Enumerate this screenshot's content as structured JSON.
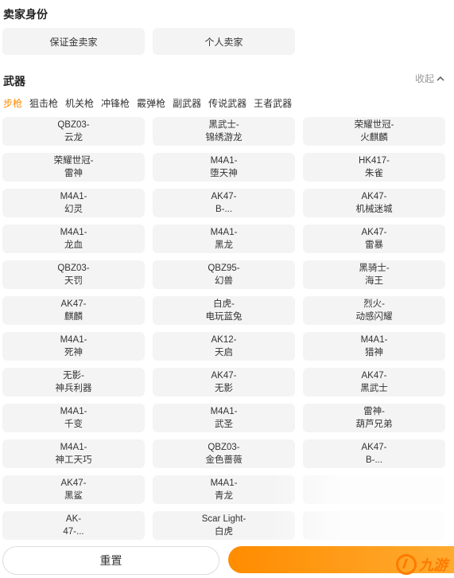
{
  "seller": {
    "title": "卖家身份",
    "options": [
      "保证金卖家",
      "个人卖家"
    ]
  },
  "weapons": {
    "title": "武器",
    "collapse_label": "收起",
    "tabs": [
      "步枪",
      "狙击枪",
      "机关枪",
      "冲锋枪",
      "霰弹枪",
      "副武器",
      "传说武器",
      "王者武器"
    ],
    "active_tab": 0,
    "items": [
      [
        "QBZ03-",
        "云龙"
      ],
      [
        "黑武士-",
        "锦绣游龙"
      ],
      [
        "荣耀世冠-",
        "火麒麟"
      ],
      [
        "荣耀世冠-",
        "雷神"
      ],
      [
        "M4A1-",
        "堕天神"
      ],
      [
        "HK417-",
        "朱雀"
      ],
      [
        "M4A1-",
        "幻灵"
      ],
      [
        "AK47-",
        "B-..."
      ],
      [
        "AK47-",
        "机械迷城"
      ],
      [
        "M4A1-",
        "龙血"
      ],
      [
        "M4A1-",
        "黑龙"
      ],
      [
        "AK47-",
        "雷暴"
      ],
      [
        "QBZ03-",
        "天罚"
      ],
      [
        "QBZ95-",
        "幻兽"
      ],
      [
        "黑骑士-",
        "海王"
      ],
      [
        "AK47-",
        "麒麟"
      ],
      [
        "白虎-",
        "电玩蓝兔"
      ],
      [
        "烈火-",
        "动感闪耀"
      ],
      [
        "M4A1-",
        "死神"
      ],
      [
        "AK12-",
        "天启"
      ],
      [
        "M4A1-",
        "猎神"
      ],
      [
        "无影-",
        "神兵利器"
      ],
      [
        "AK47-",
        "无影"
      ],
      [
        "AK47-",
        "黑武士"
      ],
      [
        "M4A1-",
        "千变"
      ],
      [
        "M4A1-",
        "武圣"
      ],
      [
        "雷神-",
        "葫芦兄弟"
      ],
      [
        "M4A1-",
        "神工天巧"
      ],
      [
        "QBZ03-",
        "金色蔷薇"
      ],
      [
        "AK47-",
        "B-..."
      ],
      [
        "AK47-",
        "黑鲨"
      ],
      [
        "M4A1-",
        "青龙"
      ],
      [
        "",
        ""
      ],
      [
        "AK-",
        "47-..."
      ],
      [
        "Scar Light-",
        "白虎"
      ],
      [
        "",
        ""
      ]
    ]
  },
  "footer": {
    "reset_label": "重置",
    "confirm_label": ""
  },
  "watermark": {
    "text": "九游"
  },
  "colors": {
    "accent": "#ff8a00",
    "cell_bg": "#f4f4f4"
  }
}
